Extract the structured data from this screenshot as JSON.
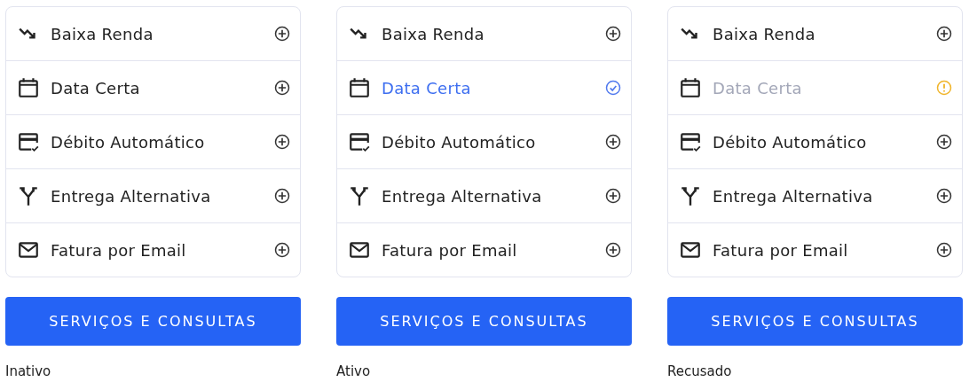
{
  "panels": [
    {
      "items": [
        {
          "kind": "trend",
          "label": "Baixa Renda",
          "checked": false,
          "warning": false
        },
        {
          "kind": "calendar",
          "label": "Data Certa",
          "checked": false,
          "warning": false
        },
        {
          "kind": "card",
          "label": "Débito Automático",
          "checked": false,
          "warning": false
        },
        {
          "kind": "split",
          "label": "Entrega Alternativa",
          "checked": false,
          "warning": false
        },
        {
          "kind": "mail",
          "label": "Fatura por Email",
          "checked": false,
          "warning": false
        }
      ],
      "button": "SERVIÇOS E CONSULTAS",
      "caption": "Inativo"
    },
    {
      "items": [
        {
          "kind": "trend",
          "label": "Baixa Renda",
          "checked": false,
          "warning": false
        },
        {
          "kind": "calendar",
          "label": "Data Certa",
          "checked": true,
          "warning": false
        },
        {
          "kind": "card",
          "label": "Débito Automático",
          "checked": false,
          "warning": false
        },
        {
          "kind": "split",
          "label": "Entrega Alternativa",
          "checked": false,
          "warning": false
        },
        {
          "kind": "mail",
          "label": "Fatura por Email",
          "checked": false,
          "warning": false
        }
      ],
      "button": "SERVIÇOS E CONSULTAS",
      "caption": "Ativo"
    },
    {
      "items": [
        {
          "kind": "trend",
          "label": "Baixa Renda",
          "checked": false,
          "warning": false
        },
        {
          "kind": "calendar",
          "label": "Data Certa",
          "checked": false,
          "warning": true
        },
        {
          "kind": "card",
          "label": "Débito Automático",
          "checked": false,
          "warning": false
        },
        {
          "kind": "split",
          "label": "Entrega Alternativa",
          "checked": false,
          "warning": false
        },
        {
          "kind": "mail",
          "label": "Fatura por Email",
          "checked": false,
          "warning": false
        }
      ],
      "button": "SERVIÇOS E CONSULTAS",
      "caption": "Recusado"
    }
  ]
}
